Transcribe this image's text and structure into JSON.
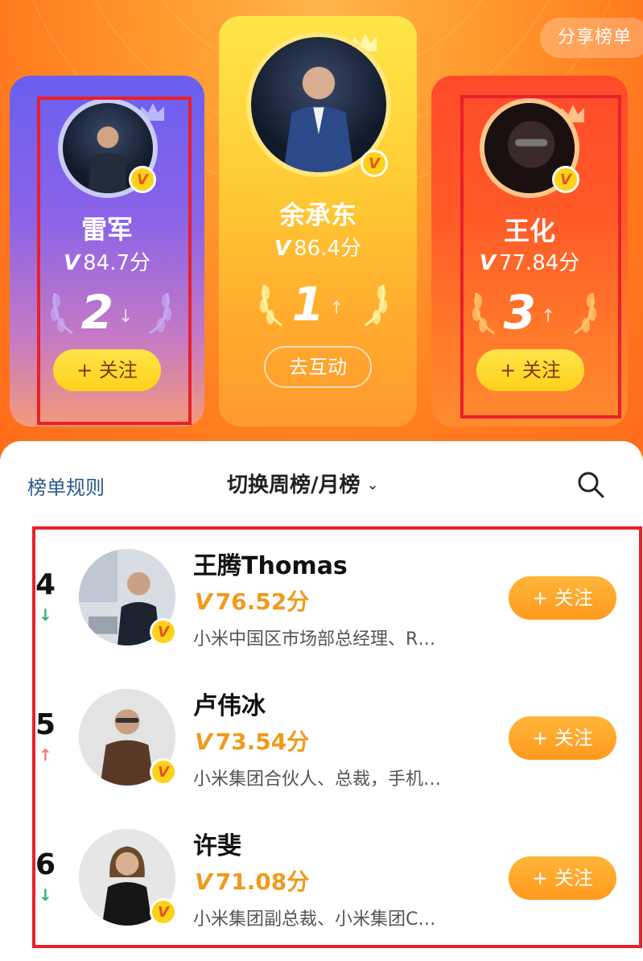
{
  "header": {
    "share_label": "分享榜单"
  },
  "podium": [
    {
      "rank": "2",
      "name": "雷军",
      "score_prefix": "V",
      "score": "84.7分",
      "action": "+ 关注",
      "trend": "↓"
    },
    {
      "rank": "1",
      "name": "余承东",
      "score_prefix": "V",
      "score": "86.4分",
      "action": "去互动",
      "trend": "↑"
    },
    {
      "rank": "3",
      "name": "王化",
      "score_prefix": "V",
      "score": "77.84分",
      "action": "+ 关注",
      "trend": "↑"
    }
  ],
  "toolbar": {
    "rules_label": "榜单规则",
    "switch_label": "切换周榜/月榜",
    "chevron": "⌄"
  },
  "list": [
    {
      "rank": "4",
      "trend": "↓",
      "trend_color": "#2bb673",
      "name": "王腾Thomas",
      "score_prefix": "V",
      "score": "76.52分",
      "desc": "小米中国区市场部总经理、R…",
      "action": "+ 关注"
    },
    {
      "rank": "5",
      "trend": "↑",
      "trend_color": "#f07a7a",
      "name": "卢伟冰",
      "score_prefix": "V",
      "score": "73.54分",
      "desc": "小米集团合伙人、总裁，手机…",
      "action": "+ 关注"
    },
    {
      "rank": "6",
      "trend": "↓",
      "trend_color": "#2bb673",
      "name": "许斐",
      "score_prefix": "V",
      "score": "71.08分",
      "desc": "小米集团副总裁、小米集团C…",
      "action": "+ 关注"
    }
  ],
  "colors": {
    "accent": "#ff9a1e",
    "highlight_box": "#e8202a",
    "rules_link": "#2a5a8a"
  }
}
